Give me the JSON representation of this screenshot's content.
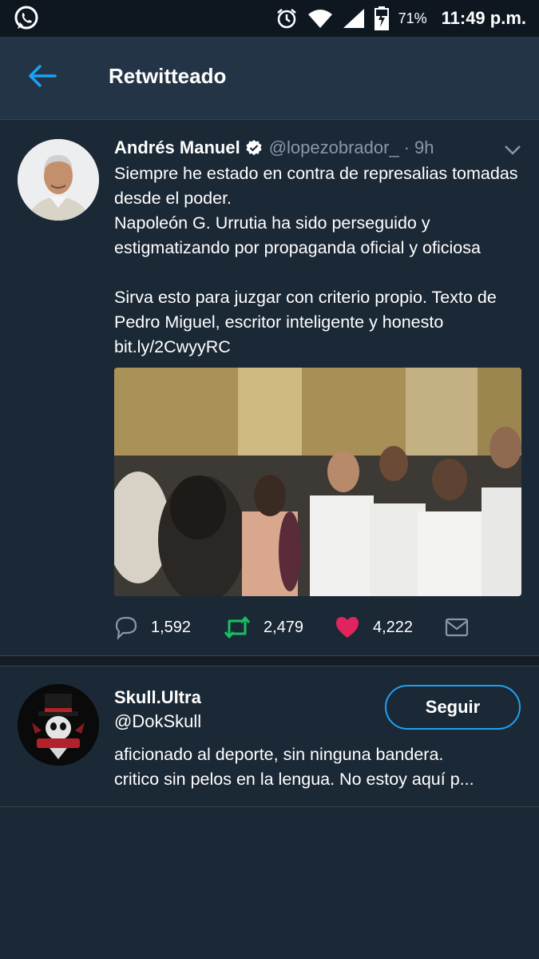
{
  "status_bar": {
    "battery_percent": "71%",
    "time": "11:49 p.m."
  },
  "header": {
    "title": "Retwitteado"
  },
  "tweet": {
    "author_name": "Andrés Manuel",
    "author_handle": "@lopezobrador_",
    "separator": "·",
    "time_ago": "9h",
    "text": "Siempre he estado en contra de represalias tomadas desde el poder.\nNapoleón G. Urrutia ha sido perseguido y estigmatizando por propaganda oficial y oficiosa\n\nSirva esto para juzgar con criterio propio. Texto de Pedro Miguel, escritor inteligente y honesto ",
    "link": "bit.ly/2CwyyRC",
    "replies": "1,592",
    "retweets": "2,479",
    "likes": "4,222"
  },
  "suggested_user": {
    "name": "Skull.Ultra",
    "handle": "@DokSkull",
    "bio_line1": "aficionado al deporte, sin ninguna bandera.",
    "bio_line2": "critico sin pelos en la lengua. No estoy aquí p...",
    "follow_label": "Seguir"
  },
  "icons": {
    "whatsapp": "whatsapp-icon",
    "alarm": "alarm-icon",
    "wifi": "wifi-icon",
    "signal": "signal-icon",
    "battery": "battery-charging-icon",
    "back": "back-arrow-icon",
    "verified": "verified-icon",
    "caret": "chevron-down-icon",
    "reply": "reply-icon",
    "retweet": "retweet-icon",
    "like": "heart-icon",
    "dm": "envelope-icon"
  },
  "colors": {
    "accent": "#1da1f2",
    "retweet_active": "#17bf63",
    "like_active": "#e0245e",
    "background": "#1b2836",
    "header": "#243447"
  }
}
